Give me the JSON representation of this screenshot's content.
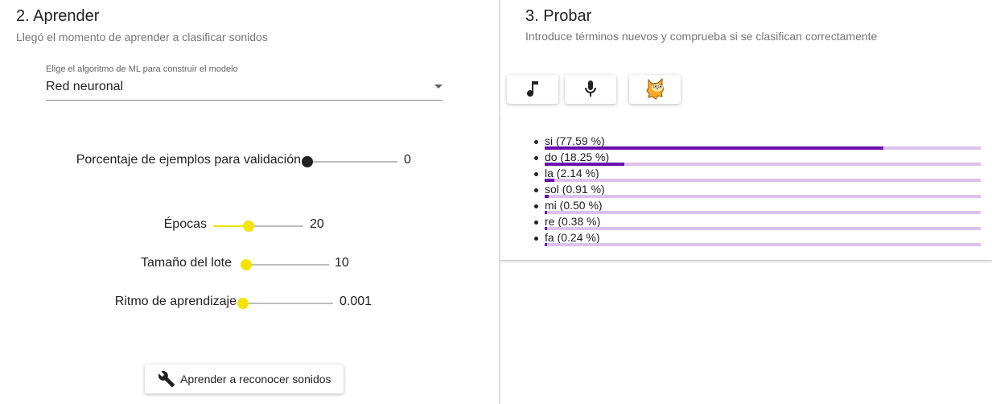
{
  "learn": {
    "title": "2. Aprender",
    "subtitle": "Llegó el momento de aprender a clasificar sonidos",
    "algorithm": {
      "label": "Elige el algoritmo de ML para construir el modelo",
      "value": "Red neuronal"
    },
    "sliders": [
      {
        "id": "validation",
        "label": "Porcentaje de ejemplos para validación",
        "value": "0",
        "fraction": 0.0
      },
      {
        "id": "epochs",
        "label": "Épocas",
        "value": "20",
        "fraction": 0.39
      },
      {
        "id": "batch",
        "label": "Tamaño del lote",
        "value": "10",
        "fraction": 0.06
      },
      {
        "id": "lr",
        "label": "Ritmo de aprendizaje",
        "value": "0.001",
        "fraction": 0.0
      }
    ],
    "train_button": "Aprender a reconocer sonidos"
  },
  "test": {
    "title": "3. Probar",
    "subtitle": "Introduce términos nuevos y comprueba si se clasifican correctamente",
    "tools": [
      "music-note-icon",
      "microphone-icon",
      "scratch-cat-icon"
    ],
    "results": [
      {
        "label": "si (77.59 %)",
        "percent": 77.59
      },
      {
        "label": "do (18.25 %)",
        "percent": 18.25
      },
      {
        "label": "la (2.14 %)",
        "percent": 2.14
      },
      {
        "label": "sol (0.91 %)",
        "percent": 0.91
      },
      {
        "label": "mi (0.50 %)",
        "percent": 0.5
      },
      {
        "label": "re (0.38 %)",
        "percent": 0.38
      },
      {
        "label": "fa (0.24 %)",
        "percent": 0.24
      }
    ]
  },
  "colors": {
    "slider_accent": "#f5e400",
    "bar_fill": "#6a0dad",
    "bar_track": "#dcc1ec"
  }
}
